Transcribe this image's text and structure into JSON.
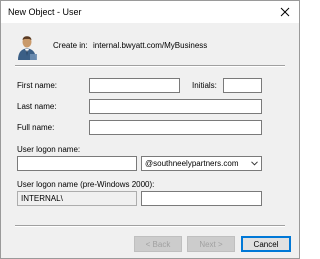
{
  "window": {
    "title": "New Object - User"
  },
  "header": {
    "create_in_label": "Create in:",
    "create_in_value": "internal.bwyatt.com/MyBusiness",
    "icon": "user-icon"
  },
  "form": {
    "first_name": {
      "label": "First name:",
      "value": ""
    },
    "initials": {
      "label": "Initials:",
      "value": ""
    },
    "last_name": {
      "label": "Last name:",
      "value": ""
    },
    "full_name": {
      "label": "Full name:",
      "value": ""
    },
    "logon_name": {
      "label": "User logon name:",
      "value": ""
    },
    "domain_suffix": {
      "selected": "@southneelypartners.com"
    },
    "pre_windows_label": "User logon name (pre-Windows 2000):",
    "pre_windows_domain": "INTERNAL\\",
    "pre_windows_name": ""
  },
  "buttons": {
    "back": "< Back",
    "next": "Next >",
    "cancel": "Cancel"
  },
  "colors": {
    "accent": "#0078d7",
    "dialog_bg": "#f0f0f0"
  }
}
